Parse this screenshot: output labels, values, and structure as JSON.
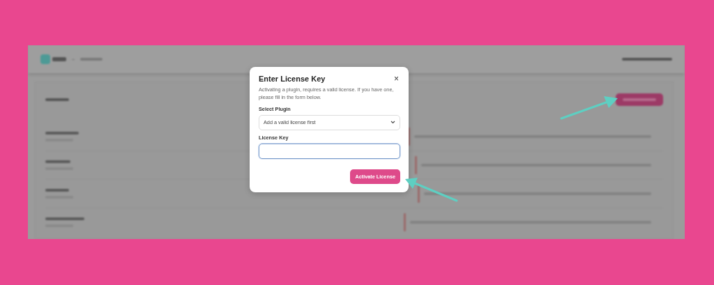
{
  "modal": {
    "title": "Enter License Key",
    "close": "×",
    "description": "Activating a plugin, requires a valid license. If you have one, please fill in the form below.",
    "fields": [
      {
        "kind": "select",
        "label": "Select Plugin",
        "value": "Add a valid license first",
        "focused": false
      },
      {
        "kind": "text",
        "label": "License Key",
        "focused": true
      }
    ],
    "button": "Activate License"
  }
}
